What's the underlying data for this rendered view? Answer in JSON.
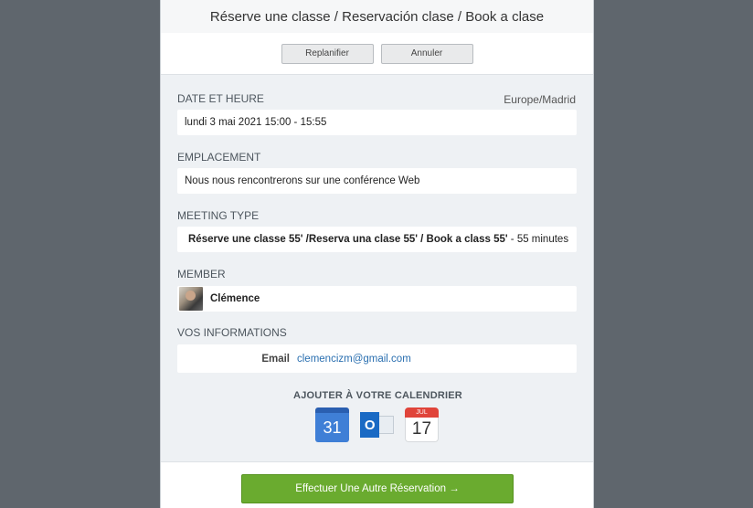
{
  "modal": {
    "title": "Réserve une classe / Reservación clase / Book a clase"
  },
  "actions": {
    "reschedule_label": "Replanifier",
    "cancel_label": "Annuler"
  },
  "date_time": {
    "label": "DATE ET HEURE",
    "timezone": "Europe/Madrid",
    "value": "lundi 3 mai 2021 15:00 - 15:55"
  },
  "location": {
    "label": "EMPLACEMENT",
    "value": "Nous nous rencontrerons sur une conférence Web"
  },
  "meeting_type": {
    "label": "MEETING TYPE",
    "name": "Réserve une classe 55' /Reserva una clase 55' / Book a class 55'",
    "duration": " - 55 minutes"
  },
  "member": {
    "label": "MEMBER",
    "name": "Clémence"
  },
  "your_info": {
    "label": "VOS INFORMATIONS",
    "email_label": "Email",
    "email_value": "clemencizm@gmail.com"
  },
  "calendar": {
    "title": "AJOUTER À VOTRE CALENDRIER",
    "google_day": "31",
    "outlook_letter": "O",
    "ical_month": "JUL",
    "ical_day": "17"
  },
  "footer": {
    "book_another_label": "Effectuer Une Autre Réservation →"
  },
  "colors": {
    "background": "#5f666d",
    "primary_button": "#6aab2f",
    "link": "#2a6fb0"
  }
}
